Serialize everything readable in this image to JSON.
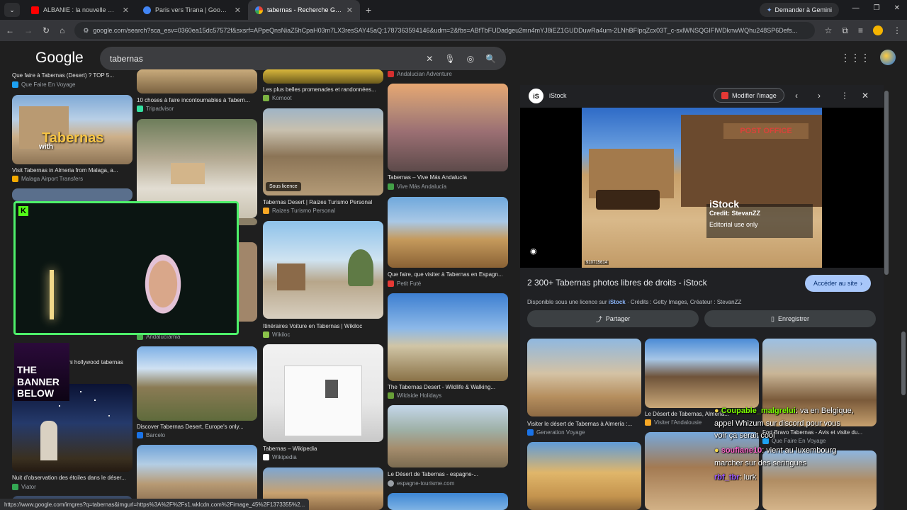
{
  "tabs": [
    {
      "title": "ALBANIE : la nouvelle DESTINAT",
      "color": "#ff0000"
    },
    {
      "title": "Paris vers Tirana | Google Flight",
      "color": "#4285f4"
    },
    {
      "title": "tabernas - Recherche Google",
      "color": "#ffffff"
    }
  ],
  "gemini_label": "Demander à Gemini",
  "url": "google.com/search?sca_esv=0360ea15dc57572f&sxsrf=APpeQnsNiaZ5hCpaH03m7LX3resSAY45aQ:1787363594146&udm=2&fbs=ABfTbFUDadgeu2mn4mYJ8iEZ1GUDDuwRa4um-2LNhBFIpqZcx03T_c-sxlWNSQGIFIWDknwWQhu248SP6Defs...",
  "logo": "Google",
  "query": "tabernas",
  "results": {
    "c1": [
      {
        "caption": "Que faire à Tabernas (Desert) ? TOP 5...",
        "source": "Que Faire En Voyage"
      },
      {
        "caption": "Visit Tabernas in Almeria from Malaga, a...",
        "source": "Malaga Airport Transfers",
        "overlay": "Tabernas",
        "overlay2": "with"
      },
      {
        "caption": "mini hollywood tabernas"
      },
      {
        "caption": "Nuit d'observation des étoiles dans le déser...",
        "source": "Viator"
      }
    ],
    "c2": [
      {
        "caption": "10 choses à faire incontournables à Tabern...",
        "source": "Tripadvisor"
      },
      {
        "caption": "Discover Tabernas Desert, Europe's only...",
        "source": "Barcelo"
      },
      {
        "source": "Andalucíamia"
      }
    ],
    "c3": [
      {
        "caption": "Les plus belles promenades et randonnées...",
        "source": "Komoot"
      },
      {
        "caption": "Tabernas Desert | Raizes Turismo Personal",
        "source": "Raizes Turismo Personal",
        "badge": "Sous licence"
      },
      {
        "caption": "Itinéraires Voiture en Tabernas | Wikiloc",
        "source": "Wikiloc"
      },
      {
        "caption": "Tabernas – Wikipedia",
        "source": "Wikipedia"
      }
    ],
    "c4": [
      {
        "source": "Andalucian Adventure"
      },
      {
        "caption": "Tabernas – Vive Más Andalucía",
        "source": "Vive Más Andalucía"
      },
      {
        "caption": "Que faire, que visiter à Tabernas en Espagn...",
        "source": "Petit Futé"
      },
      {
        "caption": "The Tabernas Desert - Wildlife & Walking...",
        "source": "Wildside Holidays"
      },
      {
        "caption": "Le Désert de Tabernas - espagne-...",
        "source": "espagne-tourisme.com"
      }
    ]
  },
  "panel": {
    "site": "iStock",
    "logo_text": "iS",
    "modify_label": "Modifier l'image",
    "watermark": "iStock",
    "credit": "Credit: StevanZZ",
    "editorial": "Editorial use only",
    "image_id": "910715614",
    "sign": "POST OFFICE",
    "title": "2 300+ Tabernas photos libres de droits - iStock",
    "visit_label": "Accéder au site",
    "license_prefix": "Disponible sous une licence sur",
    "license_site": "iStock",
    "license_suffix": "· Crédits : Getty Images, Créateur : StevanZZ",
    "share_label": "Partager",
    "save_label": "Enregistrer",
    "related": [
      {
        "caption": "Visiter le désert de Tabernas à Almería :...",
        "source": "Generation Voyage"
      },
      {
        "caption": "Le Désert de Tabernas, Almería...",
        "source": "Visiter l'Andalousie"
      },
      {
        "caption": "Fort Bravo Tabernas - Avis et visite du...",
        "source": "Que Faire En Voyage"
      }
    ]
  },
  "chat": [
    {
      "user": "Coupable_malgrelui",
      "msg": ": va en Belgique,",
      "user_color": "#7cfc00"
    },
    {
      "msg": "appel Whizum sur discord pour vous"
    },
    {
      "msg": "voir ça serait cool"
    },
    {
      "user": "soufiane10",
      "msg": ": vient au luxembourg",
      "user_color": "#ff66cc"
    },
    {
      "msg": "marcher sur des seringues"
    },
    {
      "user": "rbf_tbr",
      "msg": ": lurk",
      "user_color": "#9b59ff"
    }
  ],
  "banner": [
    "THE",
    "BANNER",
    "BELOW"
  ],
  "status_url": "https://www.google.com/imgres?q=tabernas&imgurl=https%3A%2F%2Fs1.wklcdn.com%2Fimage_45%2F1373355%2..."
}
